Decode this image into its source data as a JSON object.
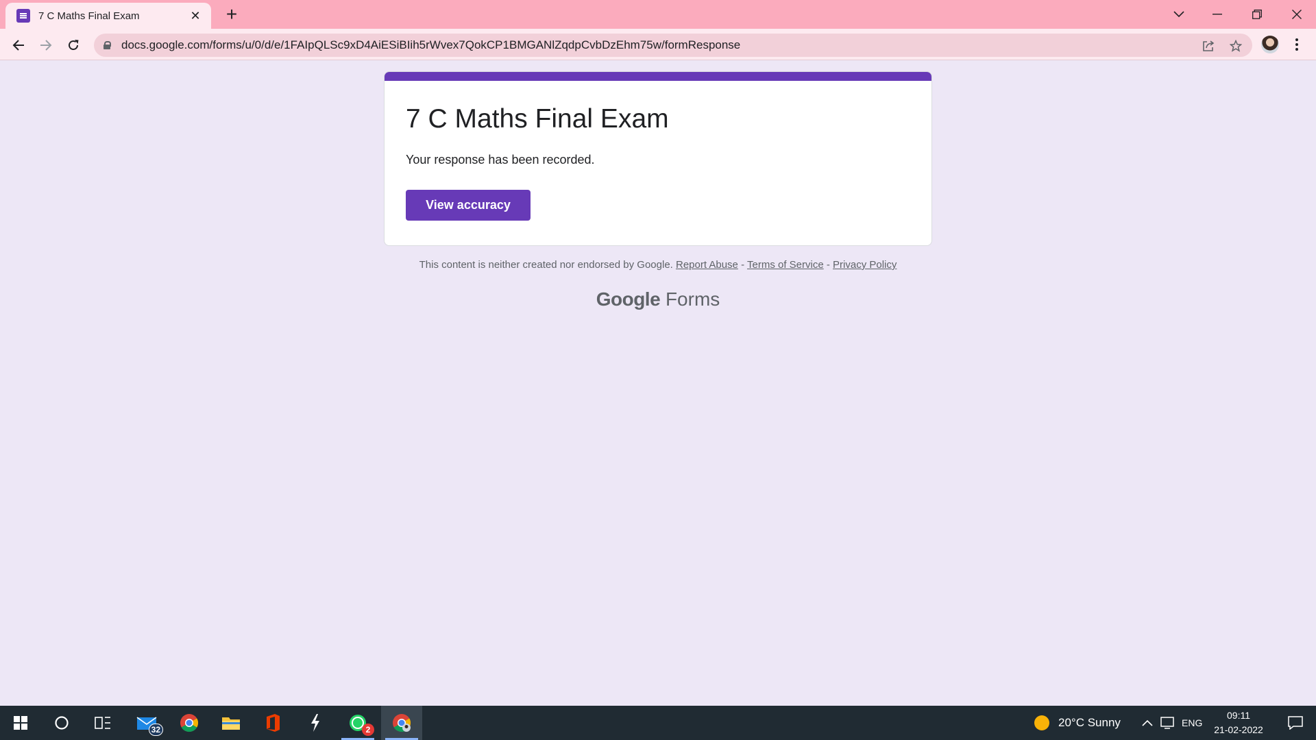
{
  "browser": {
    "tab_title": "7 C Maths Final Exam",
    "url": "docs.google.com/forms/u/0/d/e/1FAIpQLSc9xD4AiESiBIih5rWvex7QokCP1BMGANlZqdpCvbDzEhm75w/formResponse"
  },
  "form": {
    "title": "7 C Maths Final Exam",
    "message": "Your response has been recorded.",
    "button_label": "View accuracy",
    "accent_color": "#673ab7"
  },
  "footer": {
    "note": "This content is neither created nor endorsed by Google.",
    "report_abuse": "Report Abuse",
    "sep": "-",
    "terms": "Terms of Service",
    "privacy": "Privacy Policy",
    "brand_google": "Google",
    "brand_forms": "Forms"
  },
  "taskbar": {
    "mail_badge": "32",
    "whatsapp_badge": "2",
    "weather": "20°C  Sunny",
    "language": "ENG",
    "time": "09:11",
    "date": "21-02-2022"
  },
  "icons": {
    "tab_favicon": "forms-icon",
    "close": "close-icon",
    "new_tab": "plus-icon",
    "back": "back-arrow-icon",
    "forward": "forward-arrow-icon",
    "reload": "reload-icon",
    "lock": "lock-icon",
    "share": "share-icon",
    "bookmark": "star-icon"
  }
}
